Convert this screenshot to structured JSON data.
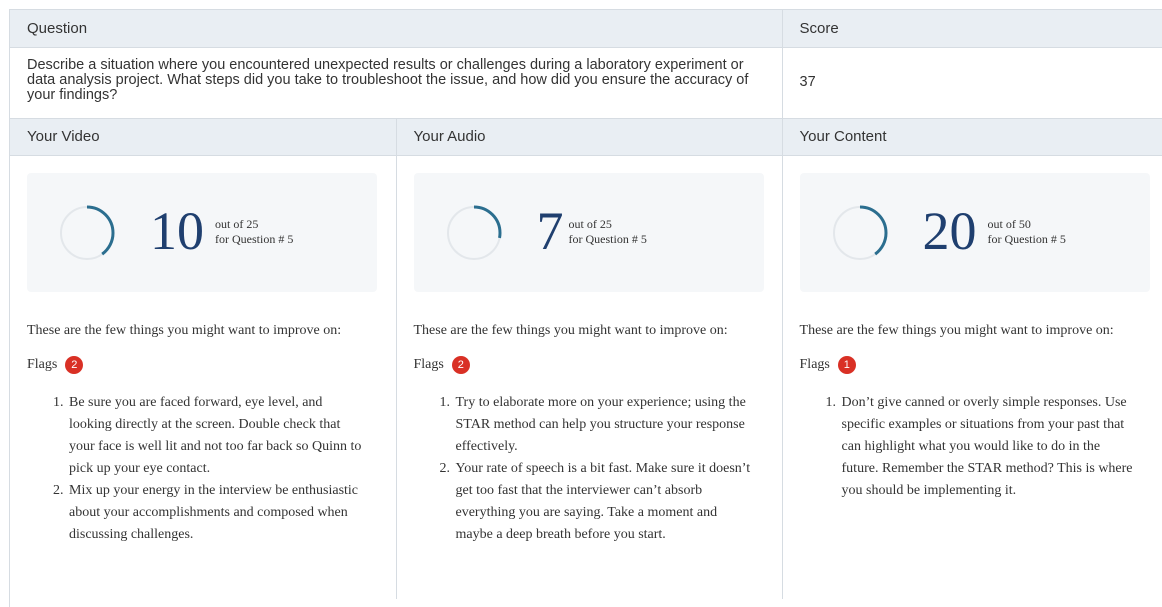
{
  "header": {
    "question_label": "Question",
    "score_label": "Score"
  },
  "question": {
    "text": "Describe a situation where you encountered unexpected results or challenges during a laboratory experiment or data analysis project. What steps did you take to troubleshoot the issue, and how did you ensure the accuracy of your findings?",
    "score": "37"
  },
  "sections": [
    {
      "title": "Your Video",
      "score": "10",
      "out_of": "out of 25",
      "question_ref": "for Question #  5",
      "progress": 0.4,
      "intro": "These are the few things you might want to improve on:",
      "flags_label": "Flags",
      "flags_count": "2",
      "items": [
        "Be sure you are faced forward, eye level, and looking directly at the screen. Double check that your face is well lit and not too far back so Quinn to pick up your eye contact.",
        "Mix up your energy in the interview be enthusiastic about your accomplishments and composed when discussing challenges."
      ]
    },
    {
      "title": "Your Audio",
      "score": "7",
      "out_of": "out of 25",
      "question_ref": "for Question #  5",
      "progress": 0.28,
      "intro": "These are the few things you might want to improve on:",
      "flags_label": "Flags",
      "flags_count": "2",
      "items": [
        "Try to elaborate more on your experience; using the STAR method can help you structure your response effectively.",
        "Your rate of speech is a bit fast. Make sure it doesn’t get too fast that the interviewer can’t absorb everything you are saying. Take a moment and maybe a deep breath before you start."
      ]
    },
    {
      "title": "Your Content",
      "score": "20",
      "out_of": "out of 50",
      "question_ref": "for Question #  5",
      "progress": 0.4,
      "intro": "These are the few things you might want to improve on:",
      "flags_label": "Flags",
      "flags_count": "1",
      "items": [
        "Don’t give canned or overly simple responses. Use specific examples or situations from your past that can highlight what you would like to do in the future. Remember the STAR method? This is where you should be implementing it."
      ]
    }
  ],
  "colors": {
    "ring_fill": "#2b6e8f",
    "ring_track": "#e3e7eb",
    "badge": "#d93025",
    "score_number": "#1f3f6f",
    "header_bg": "#e9eef3"
  }
}
